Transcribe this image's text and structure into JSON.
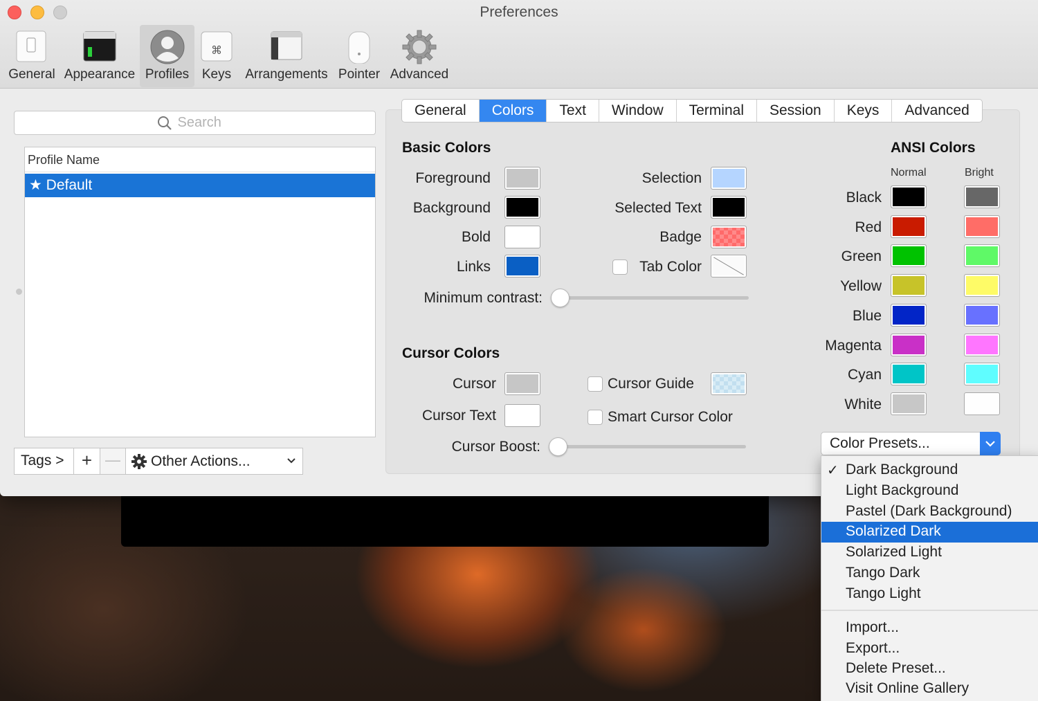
{
  "window": {
    "title": "Preferences"
  },
  "toolbar": [
    {
      "label": "General",
      "icon": "general-icon"
    },
    {
      "label": "Appearance",
      "icon": "appearance-icon"
    },
    {
      "label": "Profiles",
      "icon": "profiles-icon",
      "selected": true
    },
    {
      "label": "Keys",
      "icon": "keys-icon"
    },
    {
      "label": "Arrangements",
      "icon": "arrangements-icon"
    },
    {
      "label": "Pointer",
      "icon": "pointer-icon"
    },
    {
      "label": "Advanced",
      "icon": "advanced-icon"
    }
  ],
  "search": {
    "placeholder": "Search"
  },
  "profiles": {
    "header": "Profile Name",
    "items": [
      {
        "label": "★ Default",
        "selected": true
      }
    ]
  },
  "bottom_bar": {
    "tags_label": "Tags >",
    "add_label": "+",
    "remove_label": "—",
    "actions_label": "Other Actions..."
  },
  "tabs": [
    {
      "label": "General"
    },
    {
      "label": "Colors",
      "active": true
    },
    {
      "label": "Text"
    },
    {
      "label": "Window"
    },
    {
      "label": "Terminal"
    },
    {
      "label": "Session"
    },
    {
      "label": "Keys"
    },
    {
      "label": "Advanced"
    }
  ],
  "basic_colors": {
    "title": "Basic Colors",
    "left": [
      {
        "label": "Foreground",
        "color": "#c6c6c6"
      },
      {
        "label": "Background",
        "color": "#000000"
      },
      {
        "label": "Bold",
        "color": "#ffffff"
      },
      {
        "label": "Links",
        "color": "#0a5fc4"
      }
    ],
    "right": [
      {
        "label": "Selection",
        "color": "#b5d5ff"
      },
      {
        "label": "Selected Text",
        "color": "#000000"
      },
      {
        "label": "Badge",
        "color": "#ff8a8a"
      },
      {
        "label": "Tab Color",
        "color": "none",
        "checkbox": false
      }
    ],
    "min_contrast_label": "Minimum contrast:",
    "min_contrast_value": 0
  },
  "cursor_colors": {
    "title": "Cursor Colors",
    "cursor_label": "Cursor",
    "cursor_color": "#c6c6c6",
    "cursor_text_label": "Cursor Text",
    "cursor_text_color": "#ffffff",
    "cursor_guide_label": "Cursor Guide",
    "cursor_guide_color": "#d8ecf6",
    "cursor_guide_checked": false,
    "smart_cursor_label": "Smart Cursor Color",
    "smart_cursor_checked": false,
    "boost_label": "Cursor Boost:",
    "boost_value": 0
  },
  "ansi_colors": {
    "title": "ANSI Colors",
    "normal_header": "Normal",
    "bright_header": "Bright",
    "rows": [
      {
        "label": "Black",
        "normal": "#000000",
        "bright": "#676767"
      },
      {
        "label": "Red",
        "normal": "#c91b00",
        "bright": "#ff6d67"
      },
      {
        "label": "Green",
        "normal": "#00c200",
        "bright": "#5ff967"
      },
      {
        "label": "Yellow",
        "normal": "#c7c329",
        "bright": "#fefb67"
      },
      {
        "label": "Blue",
        "normal": "#0225c7",
        "bright": "#6871ff"
      },
      {
        "label": "Magenta",
        "normal": "#c930c7",
        "bright": "#ff76ff"
      },
      {
        "label": "Cyan",
        "normal": "#00c5c7",
        "bright": "#5ffdff"
      },
      {
        "label": "White",
        "normal": "#c7c7c7",
        "bright": "#fefefe"
      }
    ]
  },
  "presets": {
    "button_label": "Color Presets...",
    "items": [
      {
        "label": "Dark Background",
        "checked": true
      },
      {
        "label": "Light Background"
      },
      {
        "label": "Pastel (Dark Background)"
      },
      {
        "label": "Solarized Dark",
        "highlighted": true
      },
      {
        "label": "Solarized Light"
      },
      {
        "label": "Tango Dark"
      },
      {
        "label": "Tango Light"
      }
    ],
    "actions": [
      {
        "label": "Import..."
      },
      {
        "label": "Export..."
      },
      {
        "label": "Delete Preset..."
      },
      {
        "label": "Visit Online Gallery"
      }
    ]
  },
  "colors": {
    "accent": "#3487f0",
    "selection": "#1a74d6",
    "menu_highlight": "#1b6fd8"
  }
}
